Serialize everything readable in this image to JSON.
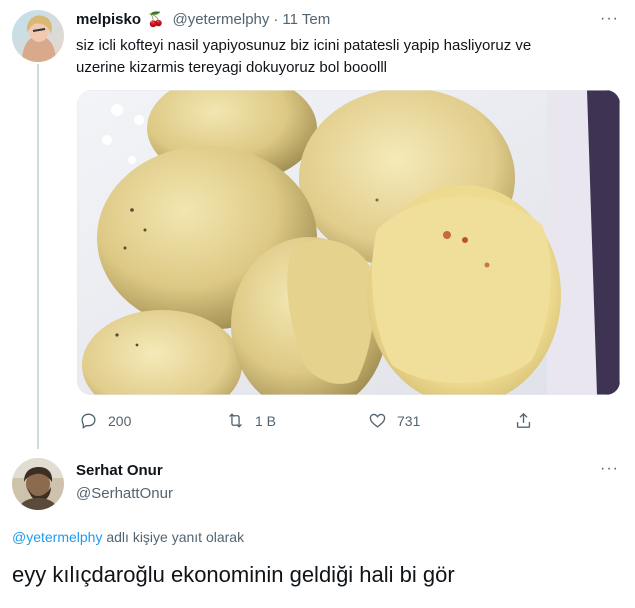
{
  "tweet": {
    "author_name": "melpisko",
    "author_emoji": "🍒",
    "handle": "@yetermelphy",
    "separator": "·",
    "date": "11 Tem",
    "more": "···",
    "text_line1": "siz icli kofteyi nasil yapiyosunuz biz icini patatesli yapip hasliyoruz ve",
    "text_line2": "uzerine kizarmis tereyagi dokuyoruz bol booolll",
    "actions": {
      "reply_count": "200",
      "retweet_count": "1 B",
      "like_count": "731"
    }
  },
  "reply": {
    "author_name": "Serhat Onur",
    "handle": "@SerhattOnur",
    "more": "···",
    "reply_to_handle": "@yetermelphy",
    "reply_to_suffix": "adlı kişiye yanıt olarak",
    "text": "eyy kılıçdaroğlu ekonominin geldiği hali bi gör"
  },
  "colors": {
    "accent": "#1d9bf0",
    "muted": "#536471",
    "text": "#0f1419",
    "line": "#cfd9de"
  },
  "icons": [
    "reply-icon",
    "retweet-icon",
    "like-icon",
    "share-icon",
    "more-icon",
    "cherry-icon"
  ]
}
